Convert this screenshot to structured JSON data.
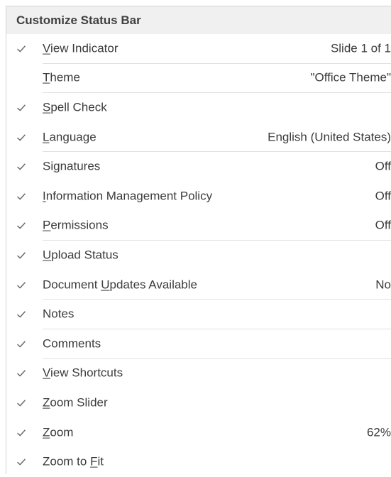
{
  "menu": {
    "title": "Customize Status Bar",
    "items": [
      {
        "pre": "",
        "acc": "V",
        "post": "iew Indicator",
        "value": "Slide 1 of 1",
        "checked": true,
        "sep": true
      },
      {
        "pre": "",
        "acc": "T",
        "post": "heme",
        "value": "\"Office Theme\"",
        "checked": false,
        "sep": true
      },
      {
        "pre": "",
        "acc": "S",
        "post": "pell Check",
        "value": "",
        "checked": true,
        "sep": false
      },
      {
        "pre": "",
        "acc": "L",
        "post": "anguage",
        "value": "English (United States)",
        "checked": true,
        "sep": true
      },
      {
        "pre": "Si",
        "acc": "g",
        "post": "natures",
        "value": "Off",
        "checked": true,
        "sep": false
      },
      {
        "pre": "",
        "acc": "I",
        "post": "nformation Management Policy",
        "value": "Off",
        "checked": true,
        "sep": false
      },
      {
        "pre": "",
        "acc": "P",
        "post": "ermissions",
        "value": "Off",
        "checked": true,
        "sep": true
      },
      {
        "pre": "",
        "acc": "U",
        "post": "pload Status",
        "value": "",
        "checked": true,
        "sep": false
      },
      {
        "pre": "Document ",
        "acc": "U",
        "post": "pdates Available",
        "value": "No",
        "checked": true,
        "sep": true
      },
      {
        "pre": "Notes",
        "acc": "",
        "post": "",
        "value": "",
        "checked": true,
        "sep": true
      },
      {
        "pre": "Comments",
        "acc": "",
        "post": "",
        "value": "",
        "checked": true,
        "sep": true
      },
      {
        "pre": "",
        "acc": "V",
        "post": "iew Shortcuts",
        "value": "",
        "checked": true,
        "sep": false
      },
      {
        "pre": "",
        "acc": "Z",
        "post": "oom Slider",
        "value": "",
        "checked": true,
        "sep": false
      },
      {
        "pre": "",
        "acc": "Z",
        "post": "oom",
        "value": "62%",
        "checked": true,
        "sep": false
      },
      {
        "pre": "Zoom to ",
        "acc": "F",
        "post": "it",
        "value": "",
        "checked": true,
        "sep": false
      }
    ]
  }
}
